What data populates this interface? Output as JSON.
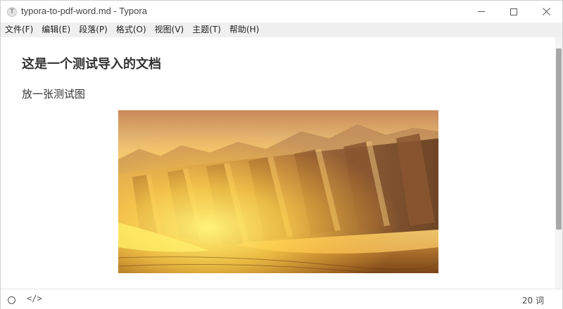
{
  "window": {
    "app_icon_letter": "T",
    "title": "typora-to-pdf-word.md - Typora"
  },
  "menu": {
    "items": [
      "文件(F)",
      "编辑(E)",
      "段落(P)",
      "格式(O)",
      "视图(V)",
      "主题(T)",
      "帮助(H)"
    ]
  },
  "document": {
    "heading": "这是一个测试导入的文档",
    "paragraph": "放一张测试图"
  },
  "statusbar": {
    "source_toggle": "</>",
    "word_count": "20 词"
  },
  "colors": {
    "menubar_bg": "#f0f0f0",
    "text": "#333333",
    "scroll_thumb": "#a8a8a8"
  },
  "icons": {
    "minimize": "minimize-icon",
    "maximize": "maximize-icon",
    "close": "close-icon",
    "outline": "circle-icon",
    "source": "code-icon"
  }
}
